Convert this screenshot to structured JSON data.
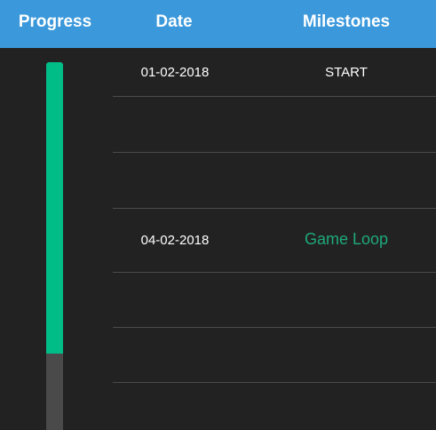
{
  "header": {
    "progress_label": "Progress",
    "date_label": "Date",
    "milestones_label": "Milestones"
  },
  "progress": {
    "value_fraction": 0.78,
    "fill_color": "#00bc87",
    "track_color": "#4a4a4a"
  },
  "rows": [
    {
      "date": "01-02-2018",
      "milestone": "START"
    },
    {
      "date": "",
      "milestone": ""
    },
    {
      "date": "",
      "milestone": ""
    },
    {
      "date": "04-02-2018",
      "milestone": "Game Loop"
    },
    {
      "date": "",
      "milestone": ""
    },
    {
      "date": "",
      "milestone": ""
    }
  ],
  "colors": {
    "header_bg": "#3a98db",
    "page_bg": "#222222",
    "accent": "#1ea97c"
  }
}
